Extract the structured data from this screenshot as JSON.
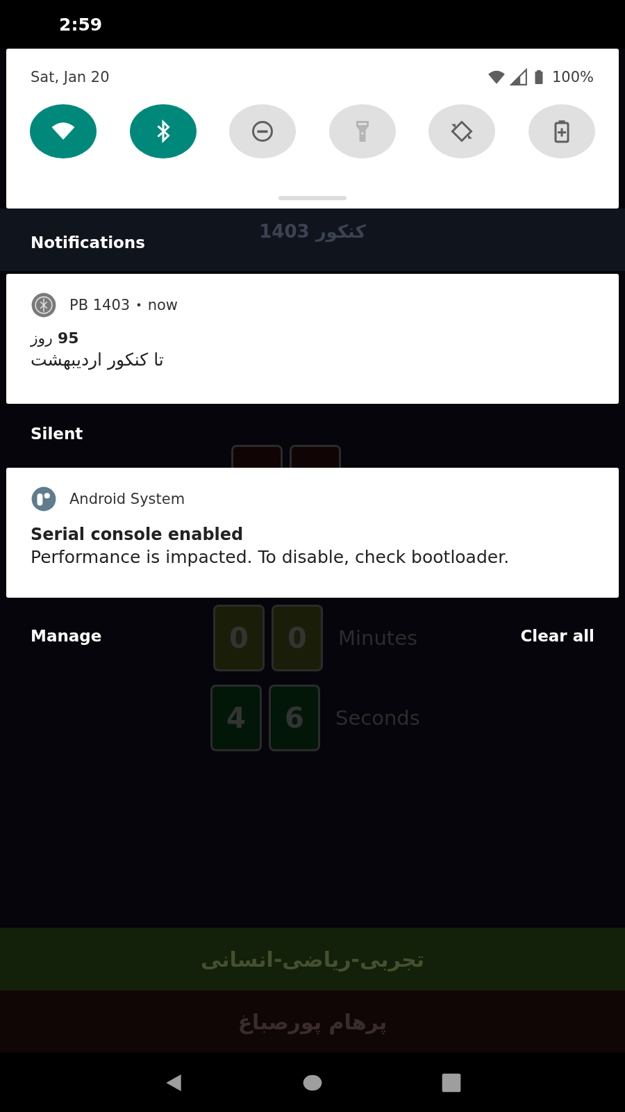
{
  "status_bar": {
    "time": "2:59"
  },
  "quick_settings": {
    "date": "Sat, Jan 20",
    "battery": "100%",
    "tiles": [
      {
        "kind": "wifi",
        "on": true,
        "disabled": false
      },
      {
        "kind": "bluetooth",
        "on": true,
        "disabled": false
      },
      {
        "kind": "dnd",
        "on": false,
        "disabled": false
      },
      {
        "kind": "flashlight",
        "on": false,
        "disabled": true
      },
      {
        "kind": "rotate",
        "on": false,
        "disabled": false
      },
      {
        "kind": "battery_saver",
        "on": false,
        "disabled": false
      }
    ]
  },
  "notifications": {
    "header": "Notifications",
    "items": [
      {
        "kind": "app",
        "app": "PB 1403",
        "separator": "•",
        "time": "now",
        "title": "**95** روز",
        "text": "تا کنکور اردیبهشت"
      }
    ]
  },
  "silent": {
    "header": "Silent",
    "items": [
      {
        "kind": "system",
        "app": "Android System",
        "title": "Serial console enabled",
        "text": "Performance is impacted. To disable, check bootloader."
      }
    ]
  },
  "actions": {
    "manage": "Manage",
    "clear_all": "Clear all"
  },
  "background_app": {
    "title": "کنکور 1403",
    "timer": [
      {
        "color": "#100404"
      },
      {
        "digits": [
          "0",
          "0"
        ],
        "unit": "Minutes",
        "color": "#1a1e08"
      },
      {
        "digits": [
          "4",
          "6"
        ],
        "unit": "Seconds",
        "color": "#031709"
      }
    ],
    "bands": [
      {
        "label": "تجربی-ریاضی-انسانی",
        "color": "#13200a"
      },
      {
        "label": "پرهام پورصباغ",
        "color": "#110606"
      }
    ]
  }
}
